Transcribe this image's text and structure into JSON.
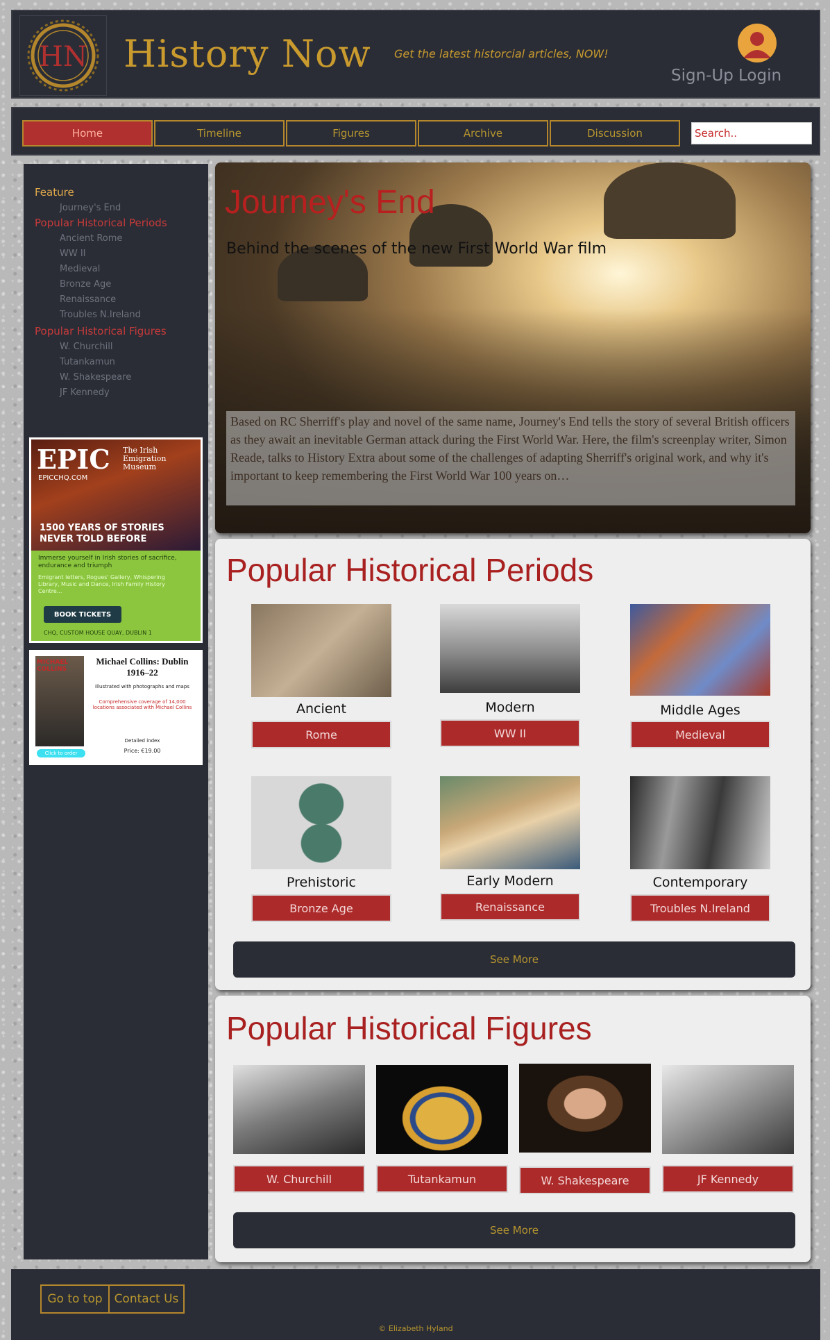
{
  "header": {
    "title": "History Now",
    "tagline": "Get the latest historcial articles, NOW!",
    "signup": "Sign-Up",
    "login": "Login",
    "logo_text": "HN"
  },
  "nav": {
    "items": [
      "Home",
      "Timeline",
      "Figures",
      "Archive",
      "Discussion"
    ],
    "active": "Home",
    "search_placeholder": "Search.."
  },
  "sidebar": {
    "feature_heading": "Feature",
    "feature_items": [
      "Journey's End"
    ],
    "periods_heading": "Popular Historical Periods",
    "period_items": [
      "Ancient Rome",
      "WW II",
      "Medieval",
      "Bronze Age",
      "Renaissance",
      "Troubles N.Ireland"
    ],
    "figures_heading": "Popular Historical Figures",
    "figure_items": [
      "W. Churchill",
      "Tutankamun",
      "W. Shakespeare",
      "JF Kennedy"
    ]
  },
  "ads": {
    "epic": {
      "title": "EPIC",
      "subtitle": "The Irish Emigration Museum",
      "url": "EPICCHQ.COM",
      "headline": "1500 YEARS OF STORIES NEVER TOLD BEFORE",
      "body": "Immerse yourself in Irish stories of sacrifice, endurance and triumph",
      "body2": "Emigrant letters, Rogues' Gallery, Whispering Library, Music and Dance, Irish Family History Centre...",
      "button": "BOOK TICKETS",
      "address": "CHQ, CUSTOM HOUSE QUAY, DUBLIN 1"
    },
    "collins": {
      "cover": "MICHAEL COLLINS",
      "title": "Michael Collins: Dublin 1916–22",
      "line1": "Illustrated with photographs and maps",
      "line2": "Comprehensive coverage of 14,000 locations associated with Michael Collins",
      "line3": "Detailed index",
      "price": "Price: €19.00",
      "button": "Click to order"
    }
  },
  "feature": {
    "title": "Journey's End",
    "subtitle": "Behind the scenes of the new First World War film",
    "description": "Based on RC Sherriff's play and novel of the same name, Journey's End tells the story of several British officers as they await an inevitable German attack during the First World War. Here, the film's screenplay writer, Simon Reade, talks to History Extra about some of the challenges of adapting Sherriff's original work, and why it's important to keep remembering the First World War 100 years on…"
  },
  "periods": {
    "title": "Popular Historical Periods",
    "items": [
      {
        "caption": "Ancient",
        "button": "Rome"
      },
      {
        "caption": "Modern",
        "button": "WW II"
      },
      {
        "caption": "Middle Ages",
        "button": "Medieval"
      },
      {
        "caption": "Prehistoric",
        "button": "Bronze Age"
      },
      {
        "caption": "Early Modern",
        "button": "Renaissance"
      },
      {
        "caption": "Contemporary",
        "button": "Troubles N.Ireland"
      }
    ],
    "see_more": "See More"
  },
  "figures": {
    "title": "Popular Historical Figures",
    "items": [
      "W. Churchill",
      "Tutankamun",
      "W. Shakespeare",
      "JF Kennedy"
    ],
    "see_more": "See More"
  },
  "footer": {
    "go_top": "Go to top",
    "contact": "Contact Us",
    "copyright": "© Elizabeth Hyland"
  },
  "colors": {
    "panel": "#2a2d36",
    "gold": "#c99a2e",
    "red": "#ad2a2a",
    "card": "#eeeeee"
  }
}
